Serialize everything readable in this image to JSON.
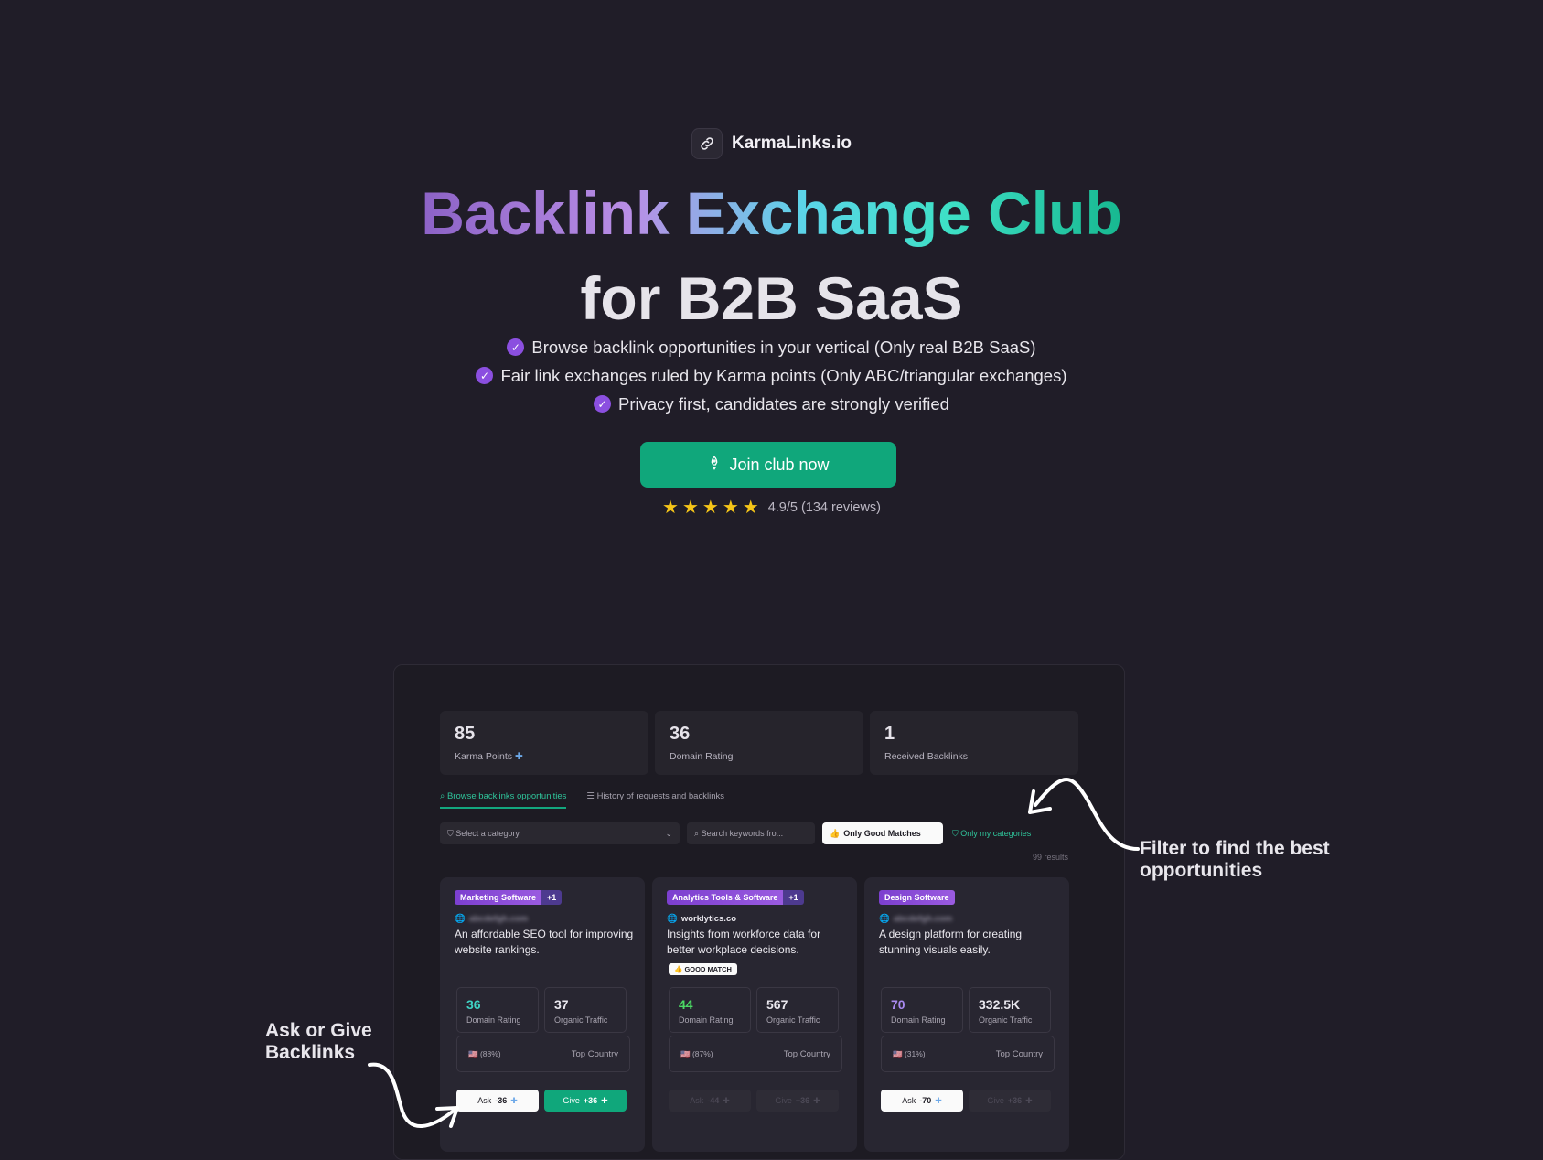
{
  "brand": {
    "name": "KarmaLinks.io",
    "icon": "link-icon"
  },
  "headline": {
    "line1": "Backlink Exchange Club",
    "line2": "for B2B SaaS"
  },
  "features": [
    "Browse backlink opportunities in your vertical (Only real B2B SaaS)",
    "Fair link exchanges ruled by Karma points (Only ABC/triangular exchanges)",
    "Privacy first, candidates are strongly verified"
  ],
  "cta": {
    "label": "Join club now",
    "icon": "rocket-icon"
  },
  "rating": {
    "stars": 5,
    "text": "4.9/5 (134 reviews)"
  },
  "dashboard": {
    "stats": [
      {
        "value": "85",
        "label": "Karma Points"
      },
      {
        "value": "36",
        "label": "Domain Rating"
      },
      {
        "value": "1",
        "label": "Received Backlinks"
      }
    ],
    "tabs": {
      "active": "Browse backlinks opportunities",
      "other": "History of requests and backlinks"
    },
    "filters": {
      "category_placeholder": "Select a category",
      "search_placeholder": "Search keywords fro...",
      "good_matches": "Only Good Matches",
      "my_categories": "Only my categories"
    },
    "results": "99 results",
    "cards": [
      {
        "tag": "Marketing Software",
        "extra": "+1",
        "domain": "abcdefgh.com",
        "domain_blurred": true,
        "description": "An affordable SEO tool for improving website rankings.",
        "good_match": "",
        "dr": "36",
        "dr_label": "Domain Rating",
        "dr_color": "#3fd2c4",
        "traffic": "37",
        "traffic_label": "Organic Traffic",
        "country_pct": "(88%)",
        "country_label": "Top Country",
        "ask": "Ask",
        "ask_value": "-36",
        "give": "Give",
        "give_value": "+36",
        "buttons_enabled": true
      },
      {
        "tag": "Analytics Tools & Software",
        "extra": "+1",
        "domain": "worklytics.co",
        "domain_blurred": false,
        "description": "Insights from workforce data for better workplace decisions.",
        "good_match": "GOOD MATCH",
        "dr": "44",
        "dr_label": "Domain Rating",
        "dr_color": "#4cd964",
        "traffic": "567",
        "traffic_label": "Organic Traffic",
        "country_pct": "(87%)",
        "country_label": "Top Country",
        "ask": "Ask",
        "ask_value": "-44",
        "give": "Give",
        "give_value": "+36",
        "buttons_enabled": false
      },
      {
        "tag": "Design Software",
        "extra": "",
        "domain": "abcdefgh.com",
        "domain_blurred": true,
        "description": "A design platform for creating stunning visuals easily.",
        "good_match": "",
        "dr": "70",
        "dr_label": "Domain Rating",
        "dr_color": "#a98af0",
        "traffic": "332.5K",
        "traffic_label": "Organic Traffic",
        "country_pct": "(31%)",
        "country_label": "Top Country",
        "ask": "Ask",
        "ask_value": "-70",
        "give": "Give",
        "give_value": "+36",
        "buttons_enabled": "ask-only"
      }
    ]
  },
  "annotations": {
    "filter_note": "Filter to find the best opportunities",
    "ask_note": "Ask or Give Backlinks"
  },
  "colors": {
    "background": "#201d28",
    "accent_green": "#10a77b",
    "accent_purple": "#8b4fe0",
    "star": "#f5c518"
  }
}
